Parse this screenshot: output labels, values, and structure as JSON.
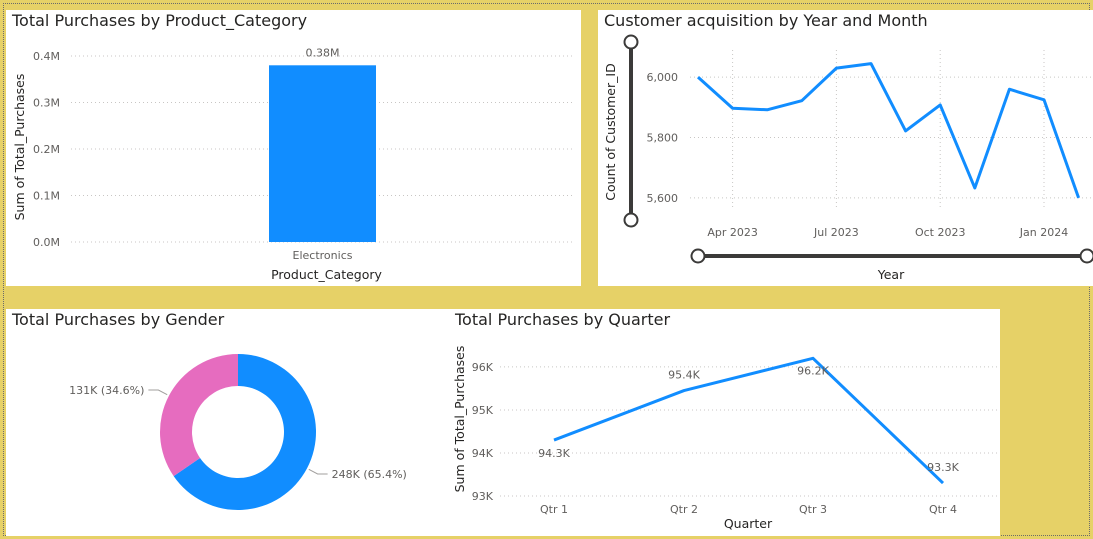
{
  "colors": {
    "background": "#e6d167",
    "series": "#118dff",
    "pink": "#e66cbf",
    "grid": "#c8c6c4",
    "slider": "#3b3a39"
  },
  "chart_data": [
    {
      "id": "category",
      "type": "bar",
      "title": "Total Purchases by Product_Category",
      "xlabel": "Product_Category",
      "ylabel": "Sum of Total_Purchases",
      "categories": [
        "Electronics"
      ],
      "values": [
        380000
      ],
      "data_labels": [
        "0.38M"
      ],
      "yticks": [
        0,
        100000,
        200000,
        300000,
        400000
      ],
      "ytick_labels": [
        "0.0M",
        "0.1M",
        "0.2M",
        "0.3M",
        "0.4M"
      ],
      "ylim": [
        0,
        400000
      ],
      "grid": true
    },
    {
      "id": "acquisition",
      "type": "line",
      "title": "Customer acquisition by Year and Month",
      "xlabel": "Year",
      "ylabel": "Count of Customer_ID",
      "x": [
        "2023-03",
        "2023-04",
        "2023-05",
        "2023-06",
        "2023-07",
        "2023-08",
        "2023-09",
        "2023-10",
        "2023-11",
        "2023-12",
        "2024-01",
        "2024-02"
      ],
      "values": [
        6000,
        5897,
        5892,
        5922,
        6030,
        6045,
        5822,
        5908,
        5633,
        5960,
        5925,
        5600
      ],
      "xtick_positions": [
        "2023-04",
        "2023-07",
        "2023-10",
        "2024-01"
      ],
      "xtick_labels": [
        "Apr 2023",
        "Jul 2023",
        "Oct 2023",
        "Jan 2024"
      ],
      "yticks": [
        5600,
        5800,
        6000
      ],
      "ytick_labels": [
        "5,600",
        "5,800",
        "6,000"
      ],
      "ylim": [
        5560,
        6090
      ],
      "grid": true
    },
    {
      "id": "gender",
      "type": "pie",
      "title": "Total Purchases by Gender",
      "slices": [
        {
          "value": 248000,
          "label": "248K (65.4%)",
          "color": "#118dff"
        },
        {
          "value": 131000,
          "label": "131K (34.6%)",
          "color": "#e66cbf"
        }
      ]
    },
    {
      "id": "quarter",
      "type": "line",
      "title": "Total Purchases by Quarter",
      "xlabel": "Quarter",
      "ylabel": "Sum of Total_Purchases",
      "categories": [
        "Qtr 1",
        "Qtr 2",
        "Qtr 3",
        "Qtr 4"
      ],
      "values": [
        94300,
        95450,
        96200,
        93300
      ],
      "data_labels": [
        "94.3K",
        "95.4K",
        "96.2K",
        "93.3K"
      ],
      "yticks": [
        93000,
        94000,
        95000,
        96000
      ],
      "ytick_labels": [
        "93K",
        "94K",
        "95K",
        "96K"
      ],
      "ylim": [
        93000,
        96300
      ],
      "grid": true
    }
  ]
}
